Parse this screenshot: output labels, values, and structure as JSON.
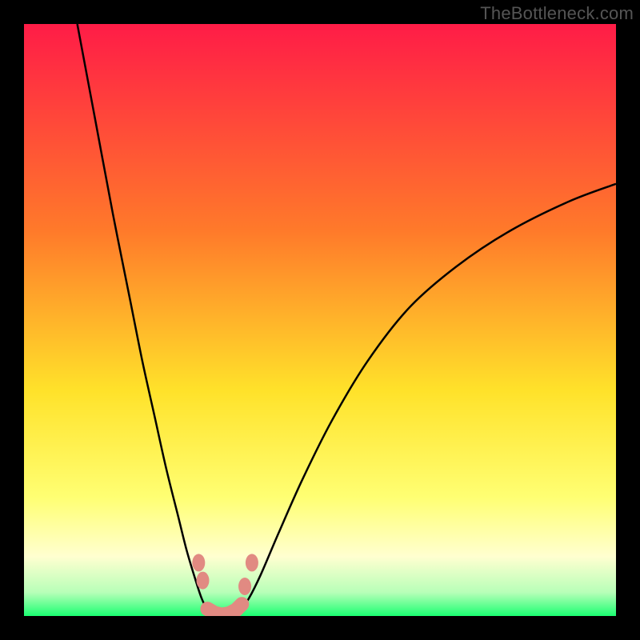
{
  "attribution": "TheBottleneck.com",
  "colors": {
    "frame": "#000000",
    "gradient_top": "#ff1c47",
    "gradient_mid_upper": "#ff7a2a",
    "gradient_mid": "#ffe22a",
    "gradient_lower": "#ffff73",
    "gradient_pale": "#ffffd0",
    "gradient_green": "#1bff72",
    "curve_stroke": "#000000",
    "marker": "#e18a82"
  },
  "chart_data": {
    "type": "line",
    "title": "",
    "xlabel": "",
    "ylabel": "",
    "xlim": [
      0,
      100
    ],
    "ylim": [
      0,
      100
    ],
    "series": [
      {
        "name": "left-curve",
        "x": [
          9,
          12,
          15,
          18,
          20,
          22,
          24,
          26,
          27.5,
          29,
          30,
          31,
          32
        ],
        "y": [
          100,
          84,
          68,
          53,
          43,
          34,
          25,
          17,
          11,
          6,
          3,
          1,
          0
        ]
      },
      {
        "name": "right-curve",
        "x": [
          36,
          38,
          40,
          43,
          47,
          52,
          58,
          65,
          73,
          82,
          92,
          100
        ],
        "y": [
          0,
          3,
          7,
          14,
          23,
          33,
          43,
          52,
          59,
          65,
          70,
          73
        ]
      }
    ],
    "markers": {
      "left_pair": [
        {
          "x": 29.5,
          "y": 9
        },
        {
          "x": 30.2,
          "y": 6
        }
      ],
      "right_pair": [
        {
          "x": 37.3,
          "y": 5
        },
        {
          "x": 38.5,
          "y": 9
        }
      ],
      "bottom_row": [
        {
          "x": 31.0,
          "y": 1.2
        },
        {
          "x": 32.2,
          "y": 0.5
        },
        {
          "x": 33.4,
          "y": 0.2
        },
        {
          "x": 34.6,
          "y": 0.4
        },
        {
          "x": 35.8,
          "y": 1.0
        },
        {
          "x": 36.8,
          "y": 2.0
        }
      ]
    },
    "gradient_stops": [
      {
        "pct": 0,
        "color": "#ff1c47"
      },
      {
        "pct": 35,
        "color": "#ff7a2a"
      },
      {
        "pct": 62,
        "color": "#ffe22a"
      },
      {
        "pct": 80,
        "color": "#ffff73"
      },
      {
        "pct": 90,
        "color": "#ffffd0"
      },
      {
        "pct": 96,
        "color": "#b8ffb8"
      },
      {
        "pct": 100,
        "color": "#1bff72"
      }
    ]
  }
}
